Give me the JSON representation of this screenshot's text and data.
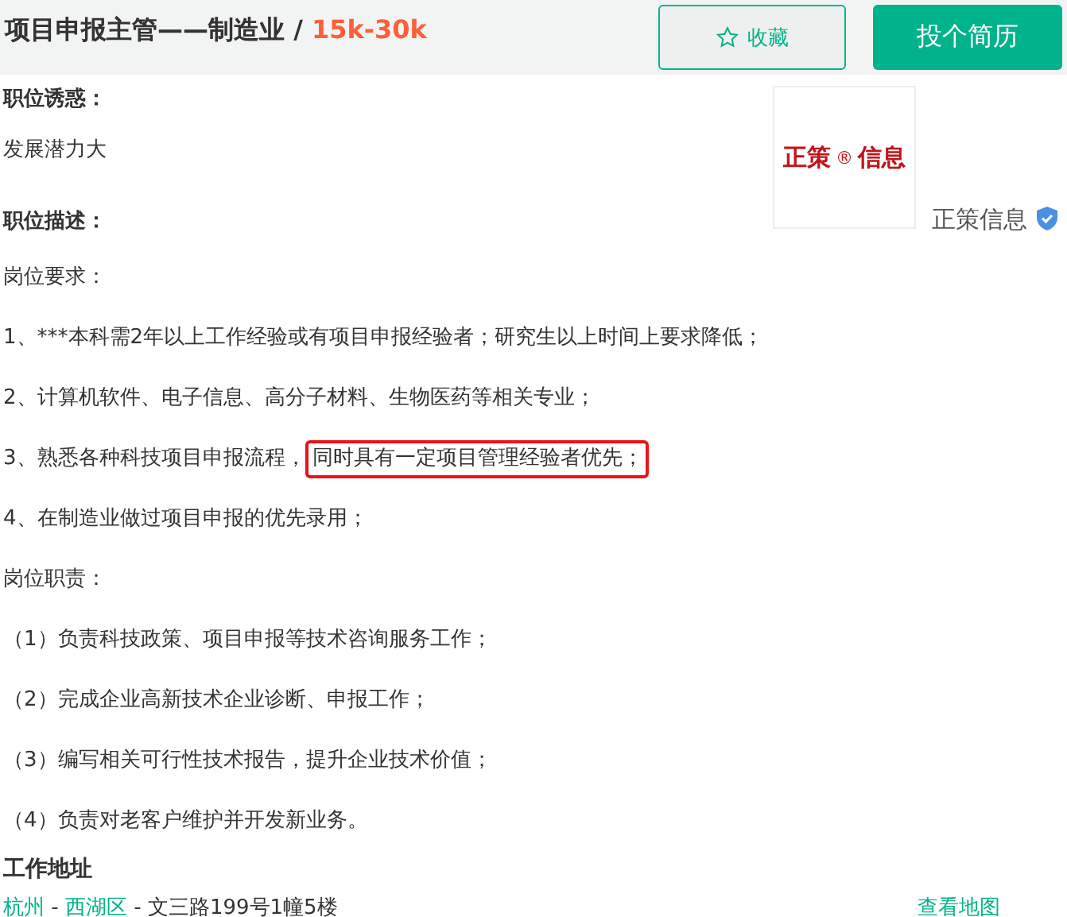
{
  "header": {
    "title": "项目申报主管——制造业 / ",
    "salary": "15k-30k",
    "buttons": [
      {
        "kind": "favorite",
        "label": "收藏"
      },
      {
        "kind": "apply",
        "label": "投个简历"
      }
    ]
  },
  "perks": {
    "heading": "职位诱惑：",
    "text": "发展潜力大"
  },
  "company": {
    "logo_text": "正策",
    "logo_mark": "®",
    "logo_text2": "信息",
    "name": "正策信息",
    "verified": true
  },
  "description": {
    "heading": "职位描述：",
    "blocks": [
      {
        "kind": "para",
        "text": "岗位要求："
      },
      {
        "kind": "para",
        "text": "1、***本科需2年以上工作经验或有项目申报经验者；研究生以上时间上要求降低；"
      },
      {
        "kind": "para",
        "text": "2、计算机软件、电子信息、高分子材料、生物医药等相关专业；"
      },
      {
        "kind": "marked",
        "text": "3、熟悉各种科技项目申报流程，",
        "highlight": "同时具有一定项目管理经验者优先；"
      },
      {
        "kind": "para",
        "text": "4、在制造业做过项目申报的优先录用；"
      },
      {
        "kind": "para",
        "text": "岗位职责："
      },
      {
        "kind": "para",
        "text": "（1）负责科技政策、项目申报等技术咨询服务工作；"
      },
      {
        "kind": "para",
        "text": "（2）完成企业高新技术企业诊断、申报工作；"
      },
      {
        "kind": "para",
        "text": "（3）编写相关可行性技术报告，提升企业技术价值；"
      },
      {
        "kind": "para",
        "text": "（4）负责对老客户维护并开发新业务。"
      }
    ]
  },
  "address": {
    "heading": "工作地址",
    "city": "杭州",
    "sep1": " - ",
    "district": "西湖区",
    "sep2": " - ",
    "street": "文三路199号1幢5楼",
    "map_link": "查看地图"
  }
}
